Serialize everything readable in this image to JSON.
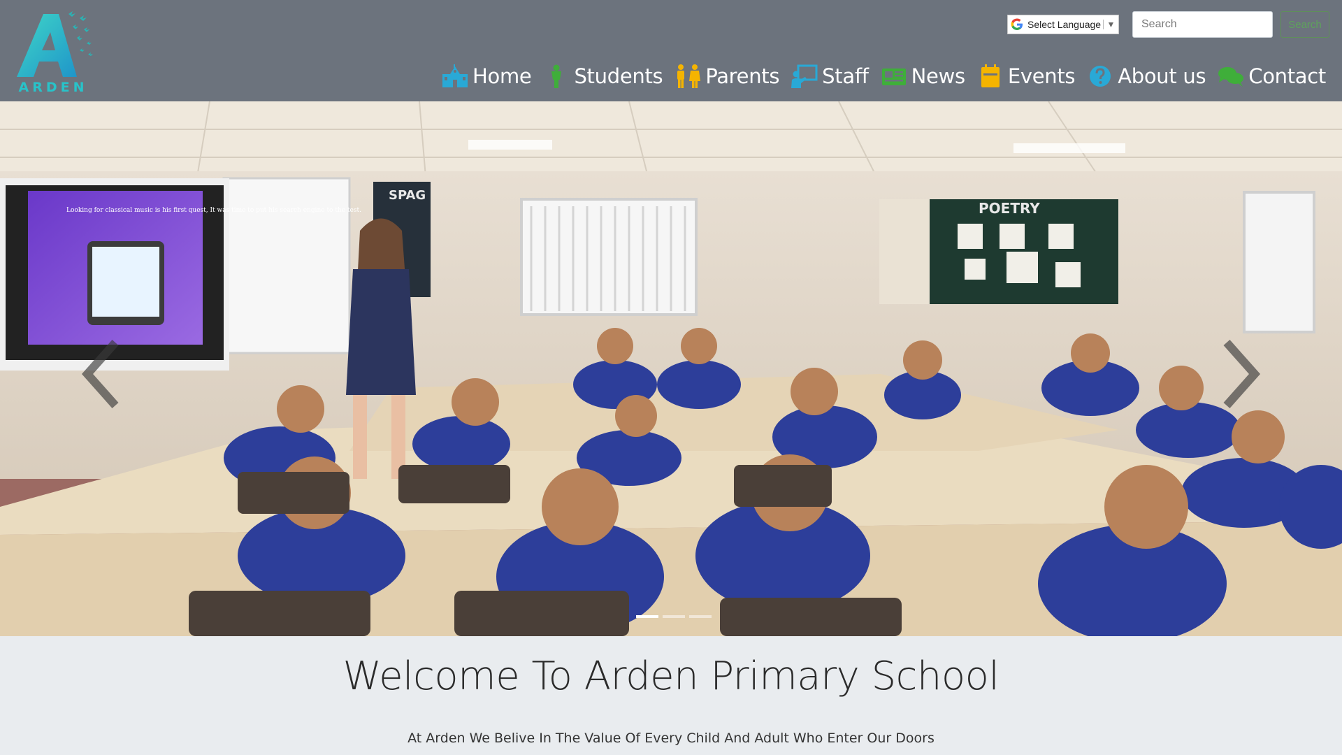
{
  "header": {
    "logo_text": "ARDEN",
    "language_select": {
      "label": "Select Language"
    },
    "search": {
      "placeholder": "Search",
      "button_label": "Search"
    },
    "nav": [
      {
        "label": "Home",
        "icon": "school-building-icon",
        "color": "#29a9d6"
      },
      {
        "label": "Students",
        "icon": "student-icon",
        "color": "#3fae3a"
      },
      {
        "label": "Parents",
        "icon": "parents-icon",
        "color": "#f5b400"
      },
      {
        "label": "Staff",
        "icon": "staff-teacher-icon",
        "color": "#29a9d6"
      },
      {
        "label": "News",
        "icon": "newspaper-icon",
        "color": "#3fae3a"
      },
      {
        "label": "Events",
        "icon": "calendar-icon",
        "color": "#f5b400"
      },
      {
        "label": "About us",
        "icon": "question-circle-icon",
        "color": "#29a9d6"
      },
      {
        "label": "Contact",
        "icon": "chat-bubbles-icon",
        "color": "#3fae3a"
      }
    ]
  },
  "hero": {
    "image_description": "classroom photo",
    "screen_text": "Looking for classical music is his first quest, It was time to put his search engine to the test.",
    "board_spag": "SPAG",
    "board_poetry": "POETRY",
    "slides": [
      {
        "active": true
      },
      {
        "active": false
      },
      {
        "active": false
      }
    ]
  },
  "welcome": {
    "title": "Welcome To Arden Primary School",
    "subtitle": "At Arden We Belive In The Value Of Every Child And Adult Who Enter Our Doors"
  },
  "colors": {
    "header_bg": "#6c737d",
    "page_bg": "#e9ecef",
    "logo_accent": "#28c3c9"
  }
}
